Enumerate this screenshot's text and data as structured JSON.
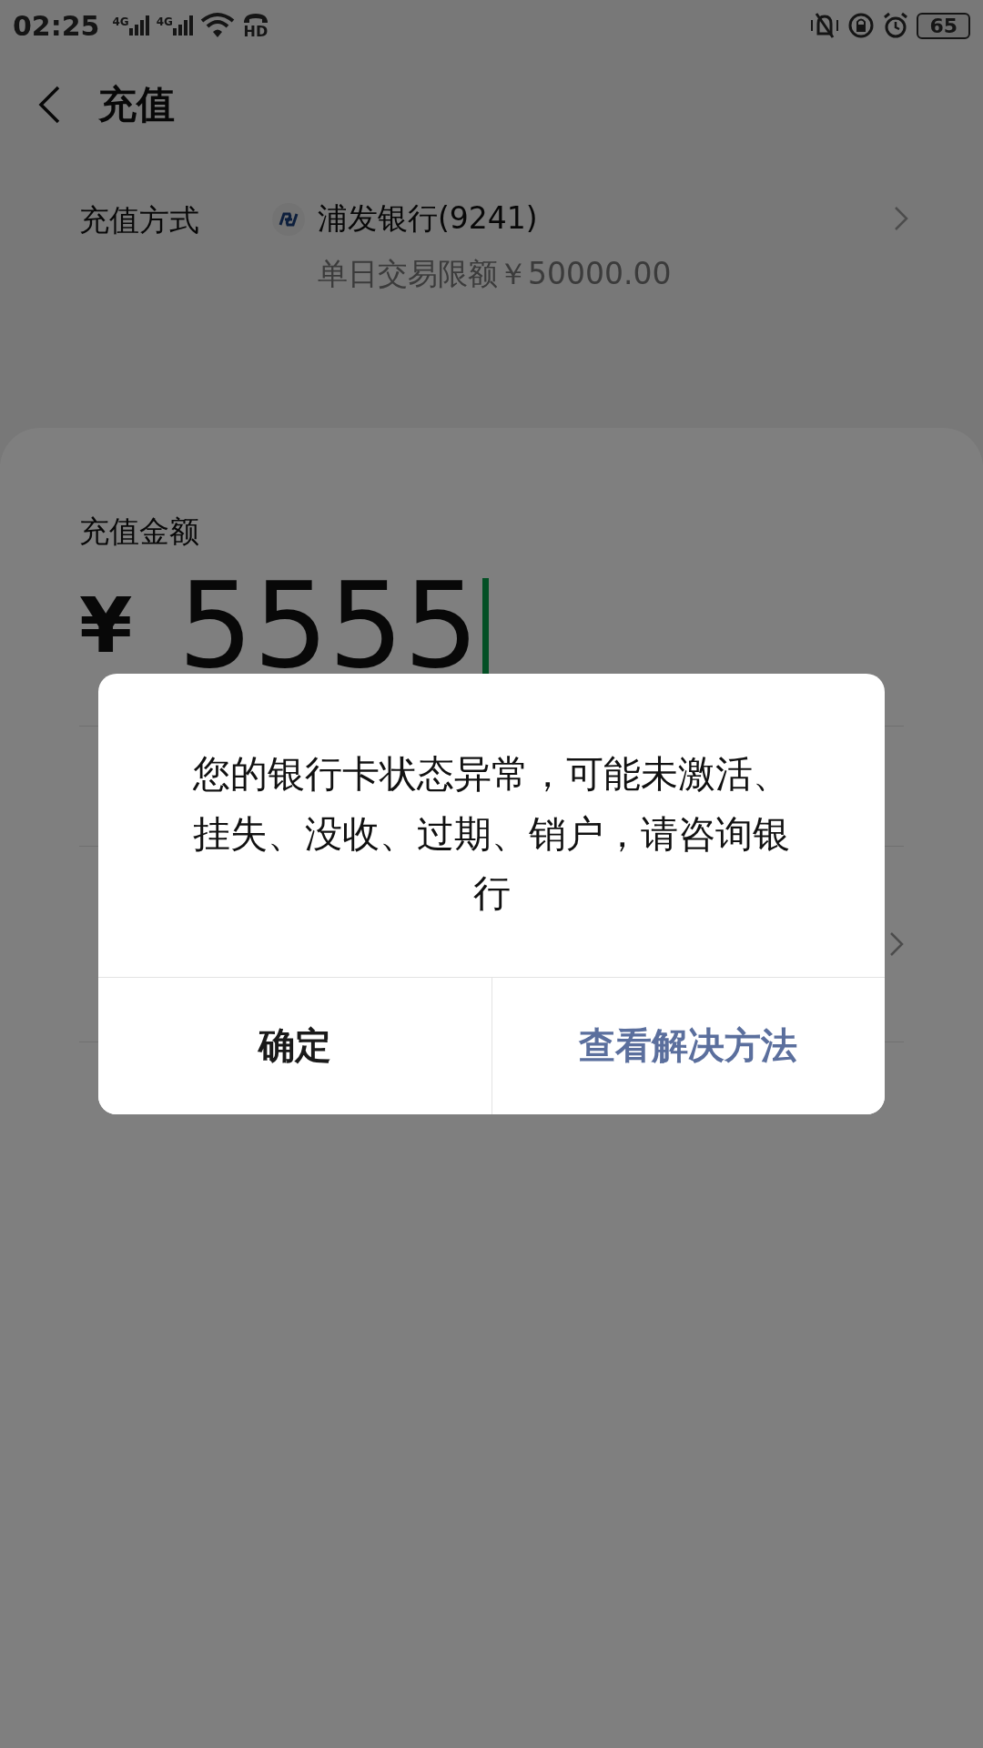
{
  "status_bar": {
    "time": "02:25",
    "network_1": "4G",
    "network_2": "4G",
    "hd": "HD",
    "battery": "65"
  },
  "header": {
    "title": "充值"
  },
  "payment_method": {
    "label": "充值方式",
    "bank": "浦发银行(9241)",
    "limit": "单日交易限额￥50000.00"
  },
  "amount": {
    "label": "充值金额",
    "currency": "¥",
    "value": "5555"
  },
  "dialog": {
    "message": "您的银行卡状态异常，可能未激活、挂失、没收、过期、销户，请咨询银行",
    "buttons": [
      {
        "label": "确定",
        "kind": "neutral"
      },
      {
        "label": "查看解决方法",
        "kind": "primary"
      }
    ]
  }
}
